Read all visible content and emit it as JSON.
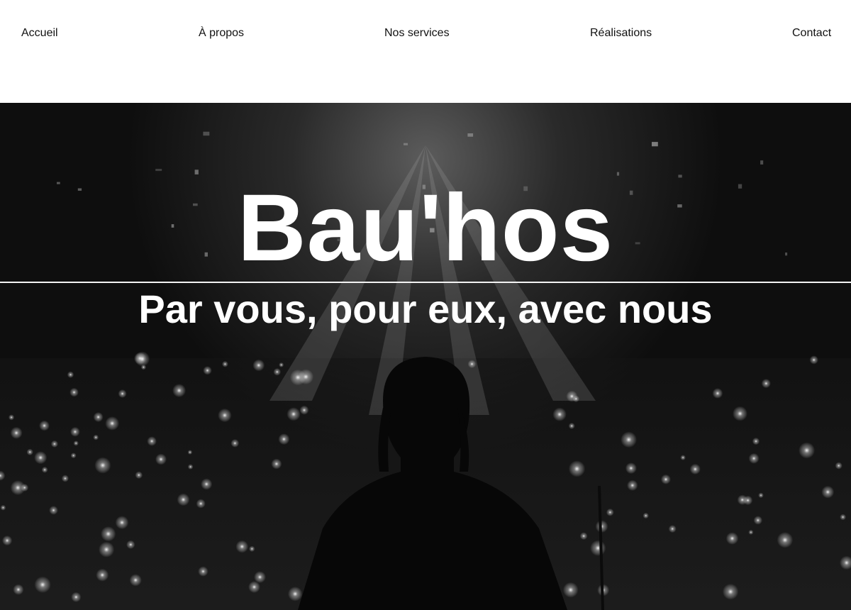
{
  "nav": {
    "items": [
      {
        "label": "Accueil"
      },
      {
        "label": "À propos"
      },
      {
        "label": "Nos services"
      },
      {
        "label": "Réalisations"
      },
      {
        "label": "Contact"
      }
    ]
  },
  "hero": {
    "title": "Bau'hos",
    "tagline": "Par vous, pour eux, avec nous",
    "background": "concert-crowd-silhouette-photo",
    "colors": {
      "overlay": "#0a0a0a",
      "text": "#ffffff"
    }
  }
}
